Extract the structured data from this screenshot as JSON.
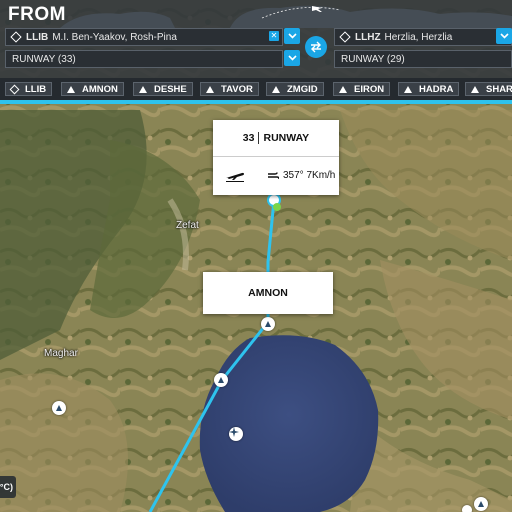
{
  "header": {
    "title": "FROM"
  },
  "departure": {
    "code": "LLIB",
    "name": "M.I. Ben-Yaakov, Rosh-Pina",
    "runway": "RUNWAY (33)"
  },
  "arrival": {
    "code": "LLHZ",
    "name": "Herzlia, Herzlia",
    "runway": "RUNWAY (29)"
  },
  "waypoints": [
    "LLIB",
    "AMNON",
    "DESHE",
    "TAVOR",
    "ZMGID",
    "EIRON",
    "HADRA",
    "SHAR"
  ],
  "map": {
    "labels": {
      "zefat": "Zefat",
      "maghar": "Maghar"
    },
    "runway_card": {
      "number": "33",
      "label": "RUNWAY",
      "wind": "357° 7Km/h"
    },
    "amnon_card": {
      "label": "AMNON"
    },
    "temp_badge": "°C)"
  },
  "colors": {
    "accent": "#1aa6e6",
    "route": "#2ec3ee",
    "panel": "#30363c"
  }
}
